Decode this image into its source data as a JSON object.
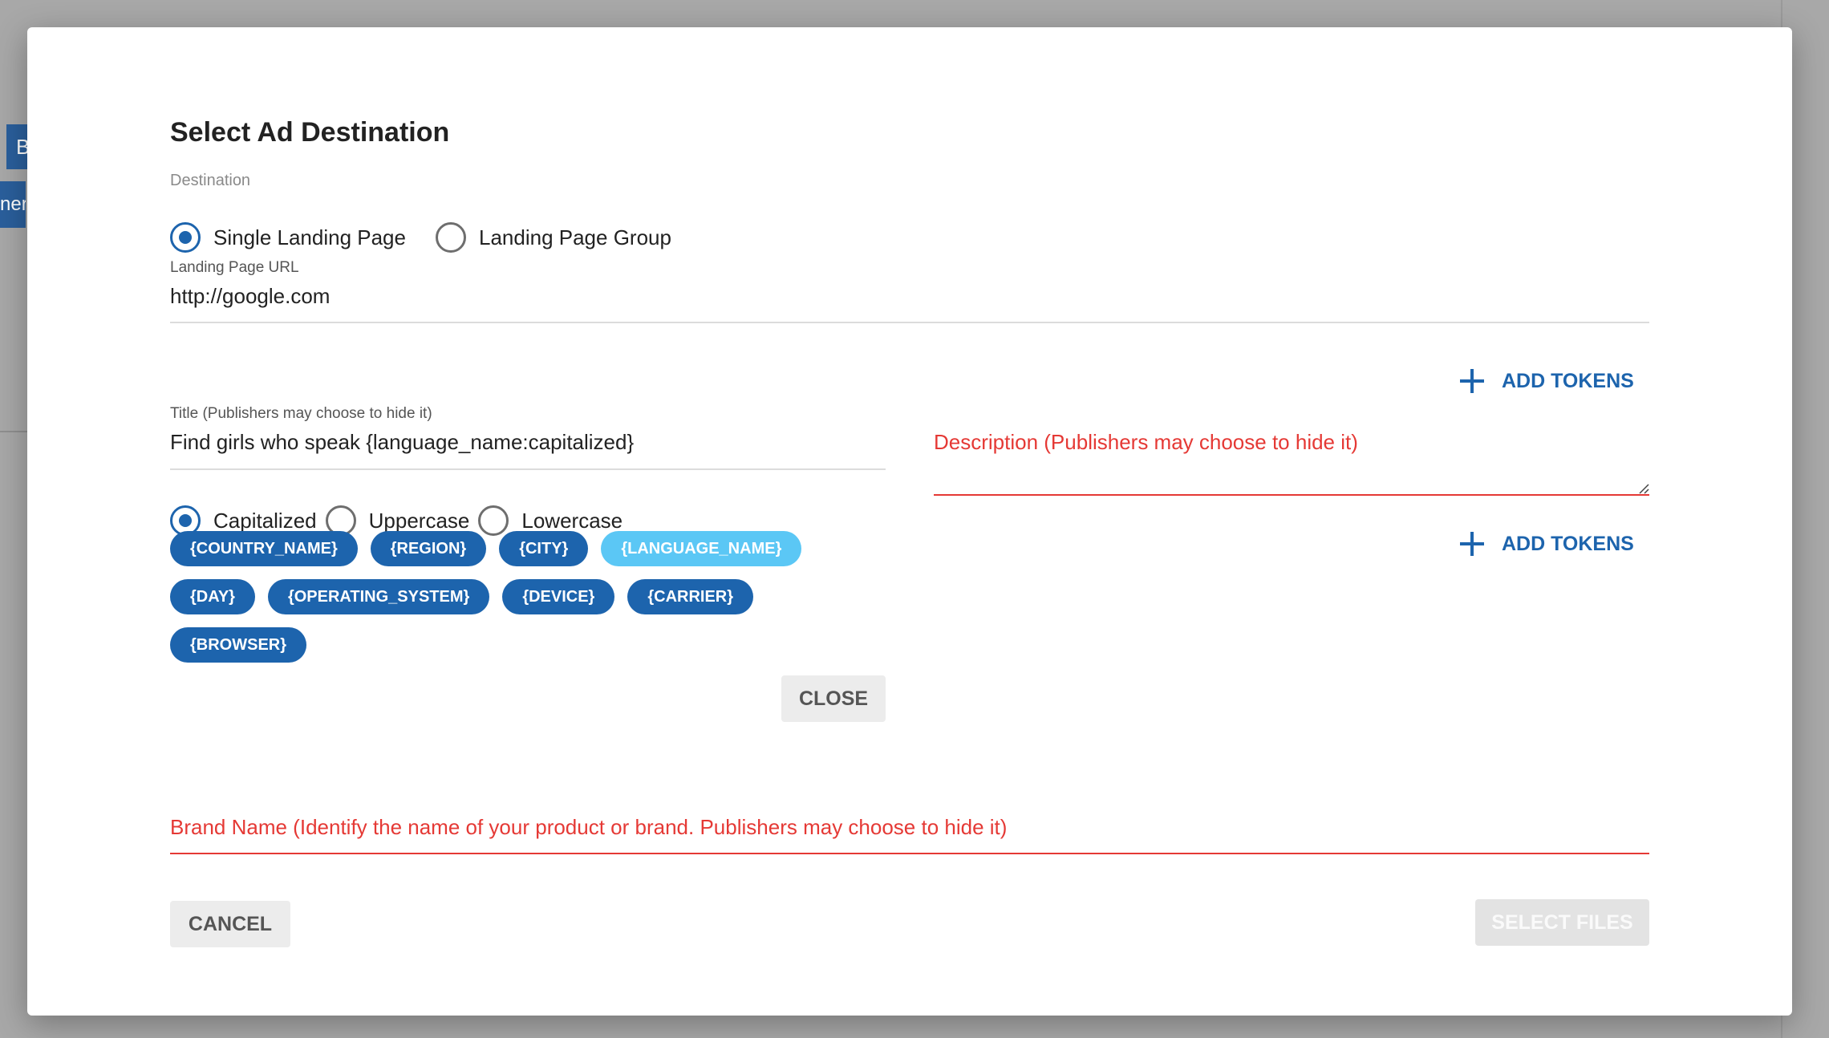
{
  "background": {
    "btn1_text": "B",
    "btn2_text": "ner"
  },
  "dialog": {
    "title": "Select Ad Destination",
    "destination": {
      "label": "Destination",
      "options": [
        {
          "label": "Single Landing Page",
          "checked": true
        },
        {
          "label": "Landing Page Group",
          "checked": false
        }
      ]
    },
    "landing_url": {
      "label": "Landing Page URL",
      "value": "http://google.com"
    },
    "add_tokens_label": "ADD TOKENS",
    "title_field": {
      "label": "Title (Publishers may choose to hide it)",
      "value": "Find girls who speak {language_name:capitalized}"
    },
    "description_field": {
      "placeholder": "Description (Publishers may choose to hide it)"
    },
    "case_options": [
      {
        "label": "Capitalized",
        "checked": true
      },
      {
        "label": "Uppercase",
        "checked": false
      },
      {
        "label": "Lowercase",
        "checked": false
      }
    ],
    "tokens": [
      {
        "label": "{COUNTRY_NAME}",
        "active": false
      },
      {
        "label": "{REGION}",
        "active": false
      },
      {
        "label": "{CITY}",
        "active": false
      },
      {
        "label": "{LANGUAGE_NAME}",
        "active": true
      },
      {
        "label": "{DAY}",
        "active": false
      },
      {
        "label": "{OPERATING_SYSTEM}",
        "active": false
      },
      {
        "label": "{DEVICE}",
        "active": false
      },
      {
        "label": "{CARRIER}",
        "active": false
      },
      {
        "label": "{BROWSER}",
        "active": false
      }
    ],
    "close_label": "CLOSE",
    "brand_field": {
      "placeholder": "Brand Name (Identify the name of your product or brand. Publishers may choose to hide it)"
    },
    "cancel_label": "CANCEL",
    "select_files_label": "SELECT FILES"
  },
  "colors": {
    "primary": "#1d64ad",
    "token_active": "#5bc7f5",
    "error": "#e53935"
  }
}
